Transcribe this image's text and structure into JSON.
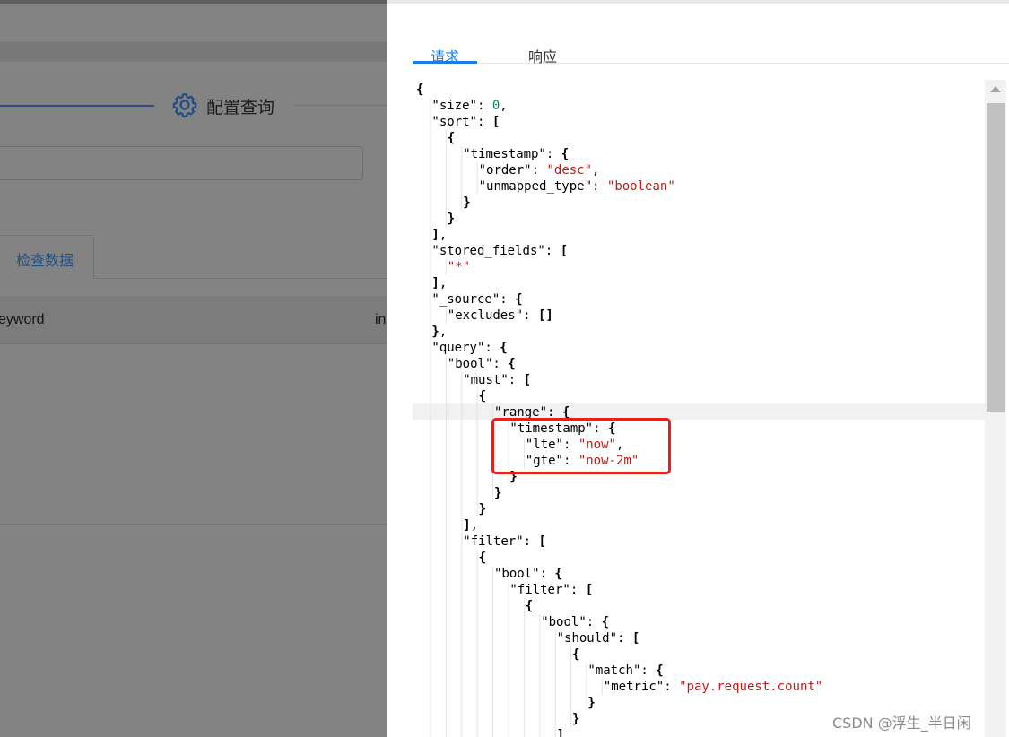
{
  "background_app": {
    "section_title": "配置查询",
    "tab_label": "检查数据",
    "table_header": {
      "col1": "eyword",
      "col2": "in"
    }
  },
  "drawer": {
    "tabs": [
      "请求",
      "响应"
    ],
    "active_tab": "请求",
    "code_lines": [
      {
        "indent": 0,
        "parts": [
          [
            "p",
            "{"
          ]
        ]
      },
      {
        "indent": 1,
        "parts": [
          [
            "k",
            "\"size\""
          ],
          [
            "k",
            ": "
          ],
          [
            "n",
            "0"
          ],
          [
            "k",
            ","
          ]
        ]
      },
      {
        "indent": 1,
        "parts": [
          [
            "k",
            "\"sort\""
          ],
          [
            "k",
            ": "
          ],
          [
            "p",
            "["
          ]
        ]
      },
      {
        "indent": 2,
        "parts": [
          [
            "p",
            "{"
          ]
        ]
      },
      {
        "indent": 3,
        "parts": [
          [
            "k",
            "\"timestamp\""
          ],
          [
            "k",
            ": "
          ],
          [
            "p",
            "{"
          ]
        ]
      },
      {
        "indent": 4,
        "parts": [
          [
            "k",
            "\"order\""
          ],
          [
            "k",
            ": "
          ],
          [
            "s",
            "\"desc\""
          ],
          [
            "k",
            ","
          ]
        ]
      },
      {
        "indent": 4,
        "parts": [
          [
            "k",
            "\"unmapped_type\""
          ],
          [
            "k",
            ": "
          ],
          [
            "s",
            "\"boolean\""
          ]
        ]
      },
      {
        "indent": 3,
        "parts": [
          [
            "p",
            "}"
          ]
        ]
      },
      {
        "indent": 2,
        "parts": [
          [
            "p",
            "}"
          ]
        ]
      },
      {
        "indent": 1,
        "parts": [
          [
            "p",
            "]"
          ],
          [
            "k",
            ","
          ]
        ]
      },
      {
        "indent": 1,
        "parts": [
          [
            "k",
            "\"stored_fields\""
          ],
          [
            "k",
            ": "
          ],
          [
            "p",
            "["
          ]
        ]
      },
      {
        "indent": 2,
        "parts": [
          [
            "s",
            "\"*\""
          ]
        ]
      },
      {
        "indent": 1,
        "parts": [
          [
            "p",
            "]"
          ],
          [
            "k",
            ","
          ]
        ]
      },
      {
        "indent": 1,
        "parts": [
          [
            "k",
            "\"_source\""
          ],
          [
            "k",
            ": "
          ],
          [
            "p",
            "{"
          ]
        ]
      },
      {
        "indent": 2,
        "parts": [
          [
            "k",
            "\"excludes\""
          ],
          [
            "k",
            ": "
          ],
          [
            "p",
            "[]"
          ]
        ]
      },
      {
        "indent": 1,
        "parts": [
          [
            "p",
            "}"
          ],
          [
            "k",
            ","
          ]
        ]
      },
      {
        "indent": 1,
        "parts": [
          [
            "k",
            "\"query\""
          ],
          [
            "k",
            ": "
          ],
          [
            "p",
            "{"
          ]
        ]
      },
      {
        "indent": 2,
        "parts": [
          [
            "k",
            "\"bool\""
          ],
          [
            "k",
            ": "
          ],
          [
            "p",
            "{"
          ]
        ]
      },
      {
        "indent": 3,
        "parts": [
          [
            "k",
            "\"must\""
          ],
          [
            "k",
            ": "
          ],
          [
            "p",
            "["
          ]
        ]
      },
      {
        "indent": 4,
        "parts": [
          [
            "p",
            "{"
          ]
        ]
      },
      {
        "indent": 5,
        "parts": [
          [
            "k",
            "\"range\""
          ],
          [
            "k",
            ": "
          ],
          [
            "p",
            "{"
          ]
        ]
      },
      {
        "indent": 6,
        "parts": [
          [
            "k",
            "\"timestamp\""
          ],
          [
            "k",
            ": "
          ],
          [
            "p",
            "{"
          ]
        ]
      },
      {
        "indent": 7,
        "parts": [
          [
            "k",
            "\"lte\""
          ],
          [
            "k",
            ": "
          ],
          [
            "s",
            "\"now\""
          ],
          [
            "k",
            ","
          ]
        ]
      },
      {
        "indent": 7,
        "parts": [
          [
            "k",
            "\"gte\""
          ],
          [
            "k",
            ": "
          ],
          [
            "s",
            "\"now-2m\""
          ]
        ]
      },
      {
        "indent": 6,
        "parts": [
          [
            "p",
            "}"
          ]
        ]
      },
      {
        "indent": 5,
        "parts": [
          [
            "p",
            "}"
          ]
        ]
      },
      {
        "indent": 4,
        "parts": [
          [
            "p",
            "}"
          ]
        ]
      },
      {
        "indent": 3,
        "parts": [
          [
            "p",
            "]"
          ],
          [
            "k",
            ","
          ]
        ]
      },
      {
        "indent": 3,
        "parts": [
          [
            "k",
            "\"filter\""
          ],
          [
            "k",
            ": "
          ],
          [
            "p",
            "["
          ]
        ]
      },
      {
        "indent": 4,
        "parts": [
          [
            "p",
            "{"
          ]
        ]
      },
      {
        "indent": 5,
        "parts": [
          [
            "k",
            "\"bool\""
          ],
          [
            "k",
            ": "
          ],
          [
            "p",
            "{"
          ]
        ]
      },
      {
        "indent": 6,
        "parts": [
          [
            "k",
            "\"filter\""
          ],
          [
            "k",
            ": "
          ],
          [
            "p",
            "["
          ]
        ]
      },
      {
        "indent": 7,
        "parts": [
          [
            "p",
            "{"
          ]
        ]
      },
      {
        "indent": 8,
        "parts": [
          [
            "k",
            "\"bool\""
          ],
          [
            "k",
            ": "
          ],
          [
            "p",
            "{"
          ]
        ]
      },
      {
        "indent": 9,
        "parts": [
          [
            "k",
            "\"should\""
          ],
          [
            "k",
            ": "
          ],
          [
            "p",
            "["
          ]
        ]
      },
      {
        "indent": 10,
        "parts": [
          [
            "p",
            "{"
          ]
        ]
      },
      {
        "indent": 11,
        "parts": [
          [
            "k",
            "\"match\""
          ],
          [
            "k",
            ": "
          ],
          [
            "p",
            "{"
          ]
        ]
      },
      {
        "indent": 12,
        "parts": [
          [
            "k",
            "\"metric\""
          ],
          [
            "k",
            ": "
          ],
          [
            "s",
            "\"pay.request.count\""
          ]
        ]
      },
      {
        "indent": 11,
        "parts": [
          [
            "p",
            "}"
          ]
        ]
      },
      {
        "indent": 10,
        "parts": [
          [
            "p",
            "}"
          ]
        ]
      },
      {
        "indent": 9,
        "parts": [
          [
            "p",
            "]"
          ]
        ]
      }
    ]
  },
  "watermark": "CSDN @浮生_半日闲",
  "colors": {
    "accent": "#1a7ee6",
    "string": "#c41a16",
    "number": "#09885a",
    "highlight_box": "#e8201a",
    "overlay": "#838383"
  },
  "icons": {
    "settings": "gear-icon",
    "scroll_up": "scroll-up-arrow-icon"
  }
}
